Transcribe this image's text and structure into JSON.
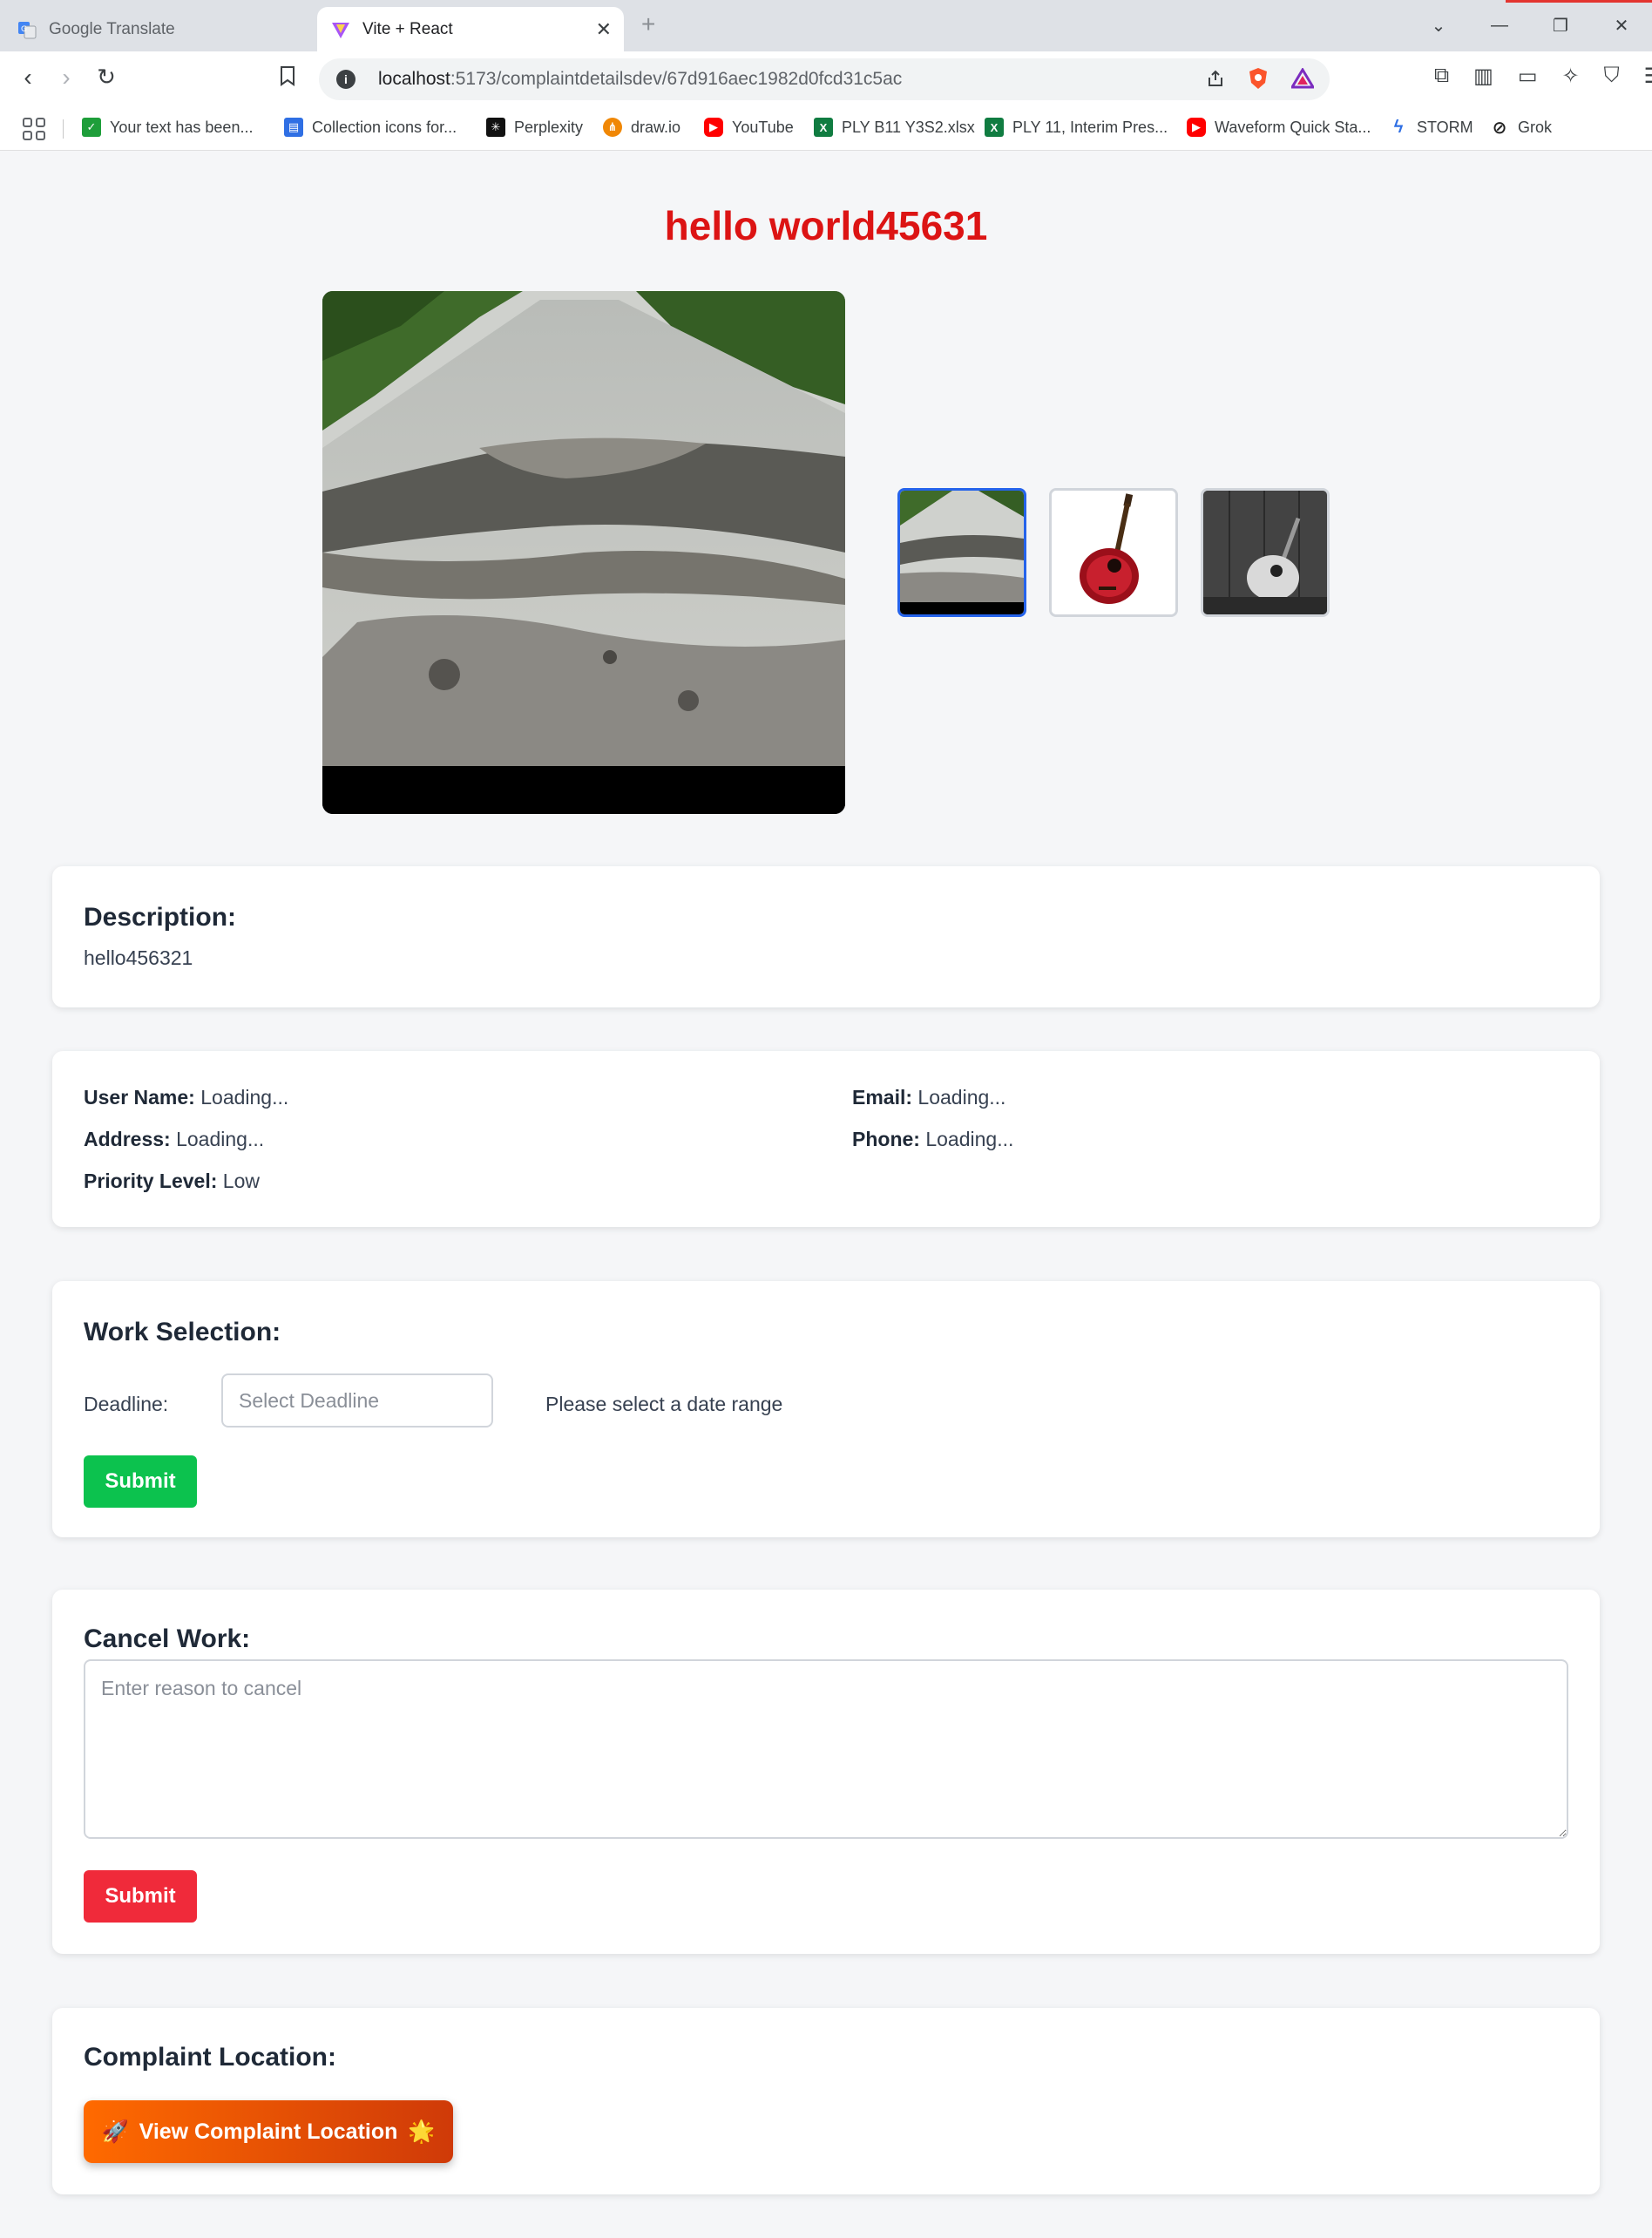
{
  "browser": {
    "tabs": [
      {
        "title": "Google Translate",
        "active": false
      },
      {
        "title": "Vite + React",
        "active": true
      }
    ],
    "url_host": "localhost",
    "url_path": ":5173/complaintdetailsdev/67d916aec1982d0fcd31c5ac",
    "bookmarks": [
      {
        "label": "Your text has been...",
        "icon": "check-icon",
        "color": "#1e9e3a"
      },
      {
        "label": "Collection icons for...",
        "icon": "collection-icon",
        "color": "#2f6fe4"
      },
      {
        "label": "Perplexity",
        "icon": "perplexity-icon",
        "color": "#111111"
      },
      {
        "label": "draw.io",
        "icon": "drawio-icon",
        "color": "#f08705"
      },
      {
        "label": "YouTube",
        "icon": "youtube-icon",
        "color": "#ff0000"
      },
      {
        "label": "PLY B11 Y3S2.xlsx",
        "icon": "excel-icon",
        "color": "#107c41"
      },
      {
        "label": "PLY 11, Interim Pres...",
        "icon": "excel-icon",
        "color": "#107c41"
      },
      {
        "label": "Waveform Quick Sta...",
        "icon": "youtube-icon",
        "color": "#ff0000"
      },
      {
        "label": "STORM",
        "icon": "storm-icon",
        "color": "#2f6fe4"
      },
      {
        "label": "Grok",
        "icon": "grok-icon",
        "color": "#222222"
      }
    ]
  },
  "page": {
    "title": "hello world45631"
  },
  "gallery": {
    "main_image": "road-damage-photo",
    "thumbnails": [
      "road-damage-photo",
      "red-guitar-photo",
      "bw-guitar-photo"
    ],
    "active_index": 0
  },
  "description": {
    "heading": "Description:",
    "text": "hello456321"
  },
  "info": {
    "user_name_label": "User Name:",
    "user_name_value": "Loading...",
    "email_label": "Email:",
    "email_value": "Loading...",
    "address_label": "Address:",
    "address_value": "Loading...",
    "phone_label": "Phone:",
    "phone_value": "Loading...",
    "priority_label": "Priority Level:",
    "priority_value": "Low"
  },
  "work": {
    "heading": "Work Selection:",
    "deadline_label": "Deadline:",
    "deadline_placeholder": "Select Deadline",
    "range_hint": "Please select a date range",
    "submit_label": "Submit"
  },
  "cancel": {
    "heading": "Cancel Work:",
    "placeholder": "Enter reason to cancel",
    "submit_label": "Submit"
  },
  "location": {
    "heading": "Complaint Location:",
    "button_label": "View Complaint Location",
    "button_icon_left": "🚀",
    "button_icon_right": "🌟"
  },
  "colors": {
    "title": "#dc1414",
    "green_button": "#0cc24e",
    "red_button": "#f02a3a",
    "orange_button": "#ff6a00",
    "thumb_active_border": "#2563eb"
  }
}
